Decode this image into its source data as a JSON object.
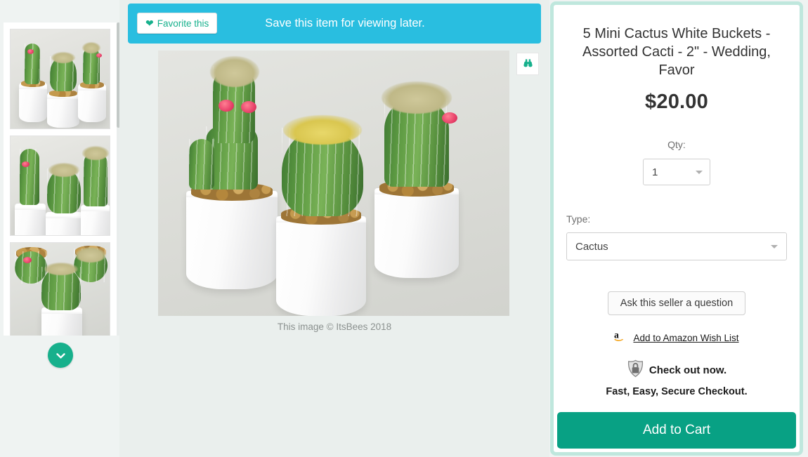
{
  "banner": {
    "favorite_label": "Favorite this",
    "favorite_icon": "heart-icon",
    "message": "Save this item for viewing later.",
    "bg_color": "#29bee0",
    "accent_color": "#16b08c"
  },
  "gallery": {
    "thumbnails": [
      {
        "alt": "Three mini cacti in white buckets"
      },
      {
        "alt": "Mini cacti close up in white buckets"
      },
      {
        "alt": "Top view of mini cacti in white buckets"
      }
    ],
    "scroll_down_icon": "chevron-down-icon",
    "zoom_icon": "binoculars-icon",
    "main_image_alt": "5 mini cactus plants in white metal buckets",
    "caption": "This image © ItsBees 2018"
  },
  "product": {
    "title": "5 Mini Cactus White Buckets - Assorted Cacti - 2\" - Wedding, Favor",
    "price": "$20.00",
    "qty_label": "Qty:",
    "qty_value": "1",
    "type_label": "Type:",
    "type_value": "Cactus",
    "ask_seller_label": "Ask this seller a question",
    "wishlist_label": "Add to Amazon Wish List",
    "wishlist_icon": "amazon-logo-icon",
    "checkout_label": "Check out now.",
    "checkout_icon": "lock-shield-icon",
    "secure_note": "Fast, Easy, Secure Checkout.",
    "add_to_cart_label": "Add to Cart",
    "cart_color": "#08a184",
    "panel_border_color": "#bfe7dd"
  }
}
